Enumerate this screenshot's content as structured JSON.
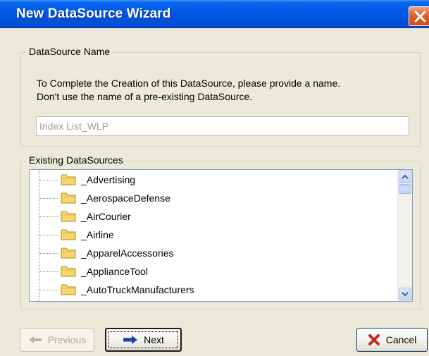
{
  "window": {
    "title": "New DataSource Wizard"
  },
  "name_group": {
    "legend": "DataSource Name",
    "instruction_line1": "To Complete the Creation of this DataSource, please provide a name.",
    "instruction_line2": "Don't use the name of a pre-existing DataSource.",
    "name_input_value": "Index List_WLP"
  },
  "existing_group": {
    "legend": "Existing DataSources",
    "items": [
      {
        "label": "_Advertising"
      },
      {
        "label": "_AerospaceDefense"
      },
      {
        "label": "_AirCourier"
      },
      {
        "label": "_Airline"
      },
      {
        "label": "_ApparelAccessories"
      },
      {
        "label": "_ApplianceTool"
      },
      {
        "label": "_AutoTruckManufacturers"
      }
    ]
  },
  "buttons": {
    "previous_label": "Previous",
    "next_label": "Next",
    "cancel_label": "Cancel"
  },
  "icons": {
    "close": "close-icon",
    "folder": "folder-icon",
    "previous_arrow": "arrow-left-icon",
    "next_arrow": "arrow-right-icon",
    "cancel": "red-x-icon",
    "scroll_up": "chevron-up-icon",
    "scroll_down": "chevron-down-icon"
  },
  "colors": {
    "titlebar": "#0058e6",
    "close_button": "#e5622e",
    "dialog_background": "#ece9d8",
    "folder_fill": "#f5d76e",
    "next_arrow": "#1c3fa3",
    "cancel_x": "#c1272d"
  }
}
